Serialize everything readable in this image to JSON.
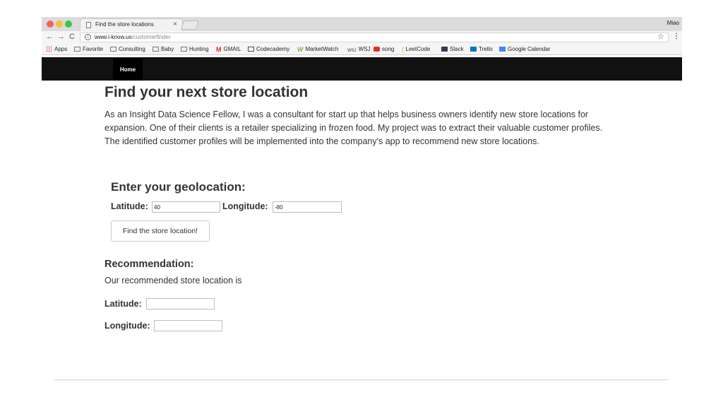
{
  "browser": {
    "tab_title": "Find the store locations",
    "tab_close": "×",
    "profile_name": "Miao",
    "nav": {
      "back": "←",
      "forward": "→",
      "reload": "C"
    },
    "url_host": "www.i-know.us",
    "url_path": "/customerfinder",
    "info_glyph": "i",
    "star_glyph": "☆",
    "menu_glyph": "⋮",
    "bookmarks": [
      {
        "label": "Apps",
        "icon": "apps-icon"
      },
      {
        "label": "Favorite",
        "icon": "folder-icon"
      },
      {
        "label": "Consulting",
        "icon": "folder-icon"
      },
      {
        "label": "Baby",
        "icon": "folder-icon"
      },
      {
        "label": "Hunting",
        "icon": "folder-icon"
      },
      {
        "label": "GMAIL",
        "icon": "gmail-icon",
        "glyph": "M"
      },
      {
        "label": "Codecademy",
        "icon": "codecademy-icon"
      },
      {
        "label": "MarketWatch",
        "icon": "marketwatch-icon",
        "glyph": "W"
      },
      {
        "label": "WSJ",
        "icon": "wsj-icon",
        "glyph": "WSJ"
      },
      {
        "label": "song",
        "icon": "youtube-icon"
      },
      {
        "label": "LeetCode",
        "icon": "leetcode-icon",
        "glyph": "{"
      },
      {
        "label": "Slack",
        "icon": "slack-icon"
      },
      {
        "label": "Trello",
        "icon": "trello-icon"
      },
      {
        "label": "Google Calendar",
        "icon": "google-calendar-icon"
      }
    ]
  },
  "navbar": {
    "home_label": "Home"
  },
  "main": {
    "title": "Find your next store location",
    "intro": "As an Insight Data Science Fellow, I was a consultant for start up that helps business owners identify new store locations for expansion. One of their clients is a retailer specializing in frozen food. My project was to extract their valuable customer profiles. The identified customer profiles will be implemented into the company's app to recommend new store locations.",
    "geo_heading": "Enter your geolocation:",
    "latitude_label": "Latitude:",
    "latitude_value": "40",
    "longitude_label": "Longitude:",
    "longitude_value": "-80",
    "find_button": "Find the store location!",
    "recommendation_heading": "Recommendation:",
    "recommendation_text": "Our recommended store location is",
    "rec_latitude_label": "Latitude:",
    "rec_latitude_value": "",
    "rec_longitude_label": "Longitude:",
    "rec_longitude_value": ""
  }
}
